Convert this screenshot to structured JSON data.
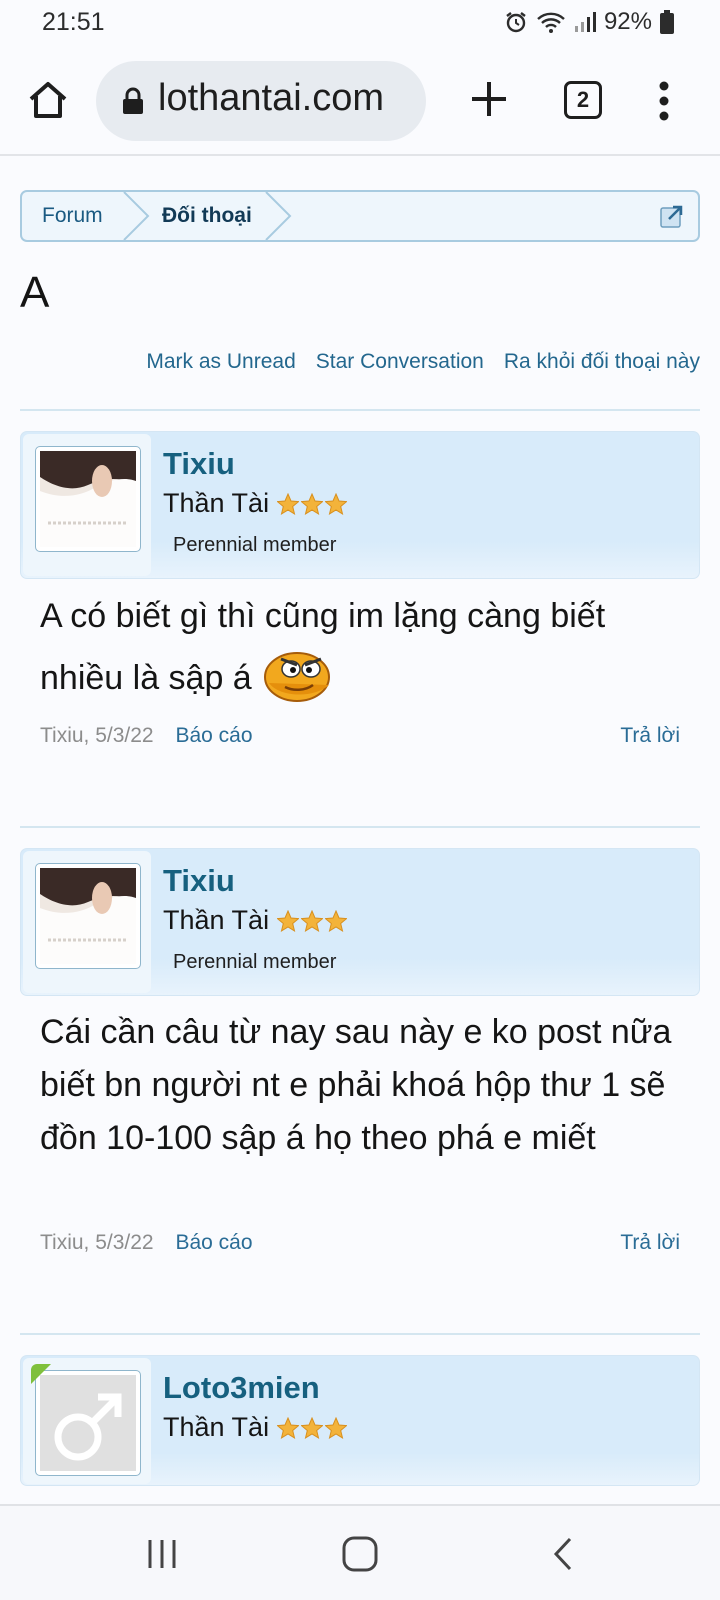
{
  "status": {
    "time": "21:51",
    "battery": "92%"
  },
  "browser": {
    "url": "lothantai.com",
    "tab_count": "2"
  },
  "breadcrumb": {
    "items": [
      "Forum",
      "Đối thoại"
    ]
  },
  "page_title": "A",
  "conversation_actions": [
    "Mark as Unread",
    "Star Conversation",
    "Ra khỏi đối thoại này"
  ],
  "messages": [
    {
      "author": "Tixiu",
      "user_title": "Thần Tài",
      "stars": 3,
      "banner": "Perennial member",
      "text": "A có biết gì thì cũng im lặng càng biết nhiều là sập á",
      "meta_author": "Tixiu, 5/3/22",
      "report": "Báo cáo",
      "reply": "Trả lời"
    },
    {
      "author": "Tixiu",
      "user_title": "Thần Tài",
      "stars": 3,
      "banner": "Perennial member",
      "text": "Cái cần câu từ nay sau này e ko post nữa biết bn người nt e phải khoá hộp thư 1 sẽ đồn 10-100 sập á họ theo phá e miết",
      "meta_author": "Tixiu, 5/3/22",
      "report": "Báo cáo",
      "reply": "Trả lời"
    },
    {
      "author": "Loto3mien",
      "user_title": "Thần Tài",
      "stars": 3
    }
  ],
  "icons": {
    "home": "home-icon",
    "lock": "lock-icon",
    "new_tab": "plus-icon",
    "menu": "more-vert-icon",
    "smiley": "angry-smiley-icon",
    "recents": "recents-icon",
    "nav_home": "nav-home-icon",
    "back": "back-icon"
  },
  "colors": {
    "link": "#23678e",
    "username": "#16607f",
    "header_bg": "#d8ebfa",
    "star": "#f3b33a"
  }
}
